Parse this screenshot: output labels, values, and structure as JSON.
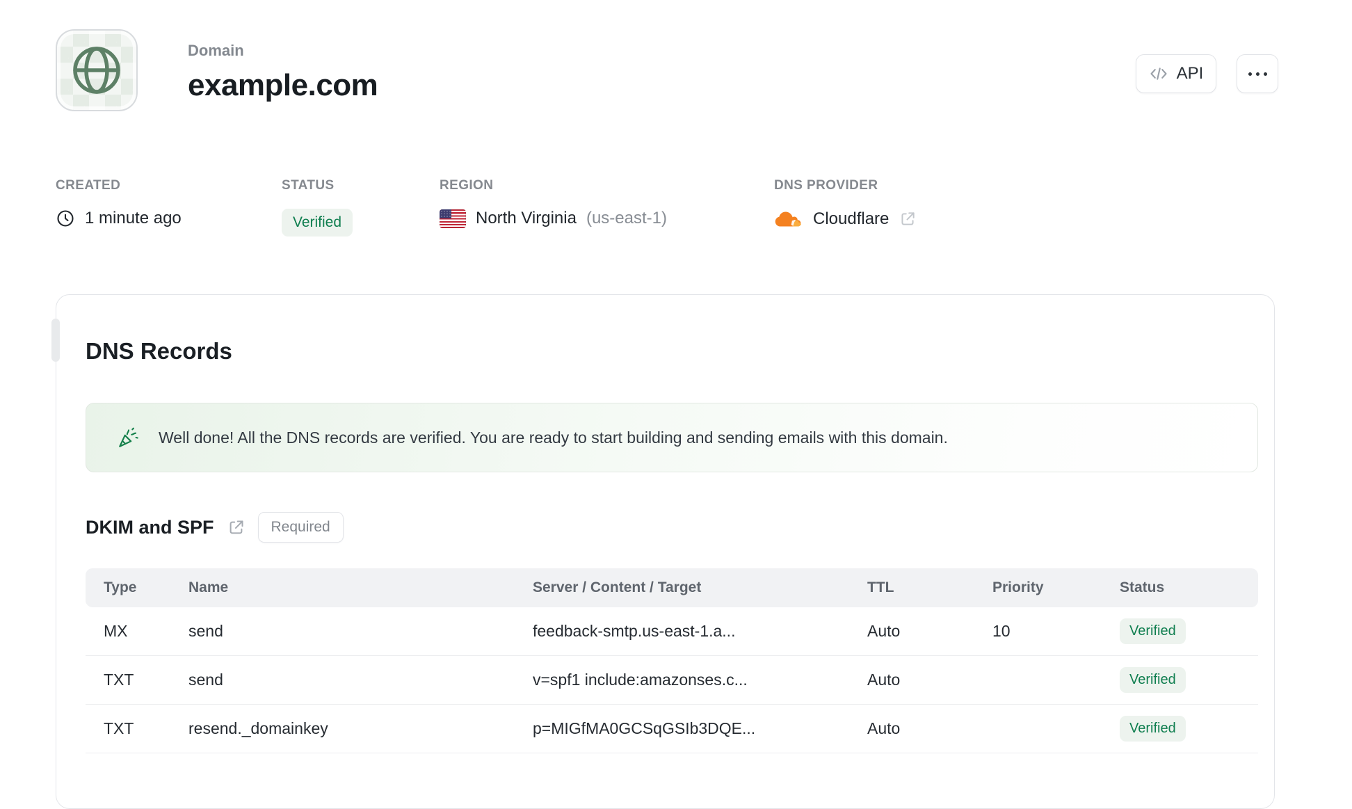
{
  "header": {
    "label": "Domain",
    "title": "example.com",
    "api_button": "API"
  },
  "meta": {
    "created": {
      "label": "CREATED",
      "value": "1 minute ago"
    },
    "status": {
      "label": "STATUS",
      "value": "Verified"
    },
    "region": {
      "label": "REGION",
      "value": "North Virginia",
      "code": "(us-east-1)"
    },
    "dns_provider": {
      "label": "DNS PROVIDER",
      "value": "Cloudflare"
    }
  },
  "dns_records": {
    "title": "DNS Records",
    "banner": "Well done! All the DNS records are verified. You are ready to start building and sending emails with this domain.",
    "section": {
      "title": "DKIM and SPF",
      "badge": "Required"
    },
    "table": {
      "headers": [
        "Type",
        "Name",
        "Server / Content / Target",
        "TTL",
        "Priority",
        "Status"
      ],
      "rows": [
        {
          "type": "MX",
          "name": "send",
          "content": "feedback-smtp.us-east-1.a...",
          "ttl": "Auto",
          "priority": "10",
          "status": "Verified"
        },
        {
          "type": "TXT",
          "name": "send",
          "content": "v=spf1 include:amazonses.c...",
          "ttl": "Auto",
          "priority": "",
          "status": "Verified"
        },
        {
          "type": "TXT",
          "name": "resend._domainkey",
          "content": "p=MIGfMA0GCSqGSIb3DQE...",
          "ttl": "Auto",
          "priority": "",
          "status": "Verified"
        }
      ]
    }
  },
  "colors": {
    "accent_green_text": "#0f7e4f",
    "accent_green_bg": "#edf3ee",
    "cloudflare_orange": "#f48120",
    "banner_green": "#e9f3e9"
  }
}
